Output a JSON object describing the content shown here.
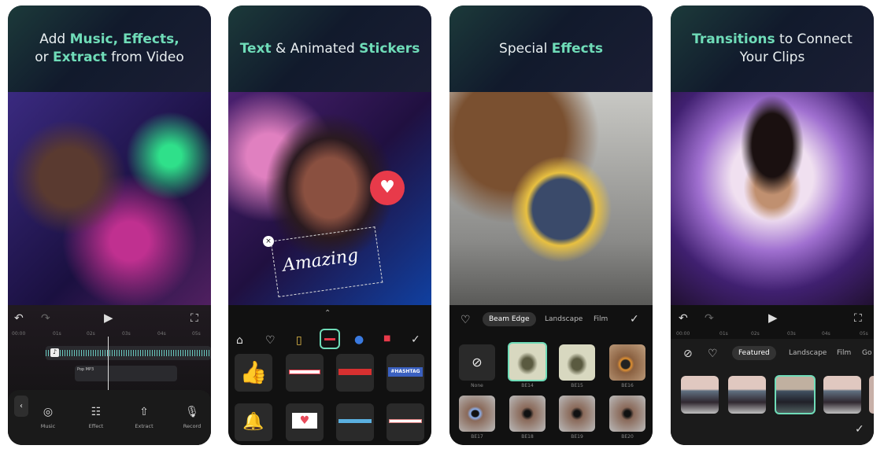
{
  "panels": [
    {
      "headline": {
        "p1": "Add ",
        "h1": "Music, Effects,",
        "p2": "or ",
        "h2": "Extract",
        "p3": " from Video"
      },
      "timeline": [
        "00:00",
        "01s",
        "02s",
        "03s",
        "04s",
        "05s"
      ],
      "audio_clip_label": "Pop MP3",
      "tools": [
        "Music",
        "Effect",
        "Extract",
        "Record"
      ]
    },
    {
      "headline": {
        "h1": "Text",
        "p1": " & Animated ",
        "h2": "Stickers"
      },
      "sticker_text": "Amazing",
      "hashtag": "#HASHTAG"
    },
    {
      "headline": {
        "p1": "Special ",
        "h1": "Effects"
      },
      "tabs": [
        "Beam Edge",
        "Landscape",
        "Film"
      ],
      "effects": [
        "None",
        "BE14",
        "BE15",
        "BE16",
        "BE17",
        "BE18",
        "BE19",
        "BE20"
      ]
    },
    {
      "headline": {
        "h1": "Transitions",
        "p1": " to Connect Your Clips"
      },
      "timeline": [
        "00:00",
        "01s",
        "02s",
        "03s",
        "04s",
        "05s"
      ],
      "tabs": [
        "Featured",
        "Landscape",
        "Film",
        "Go"
      ]
    }
  ],
  "colors": {
    "accent": "#6fdcb8",
    "background": "#141414"
  }
}
